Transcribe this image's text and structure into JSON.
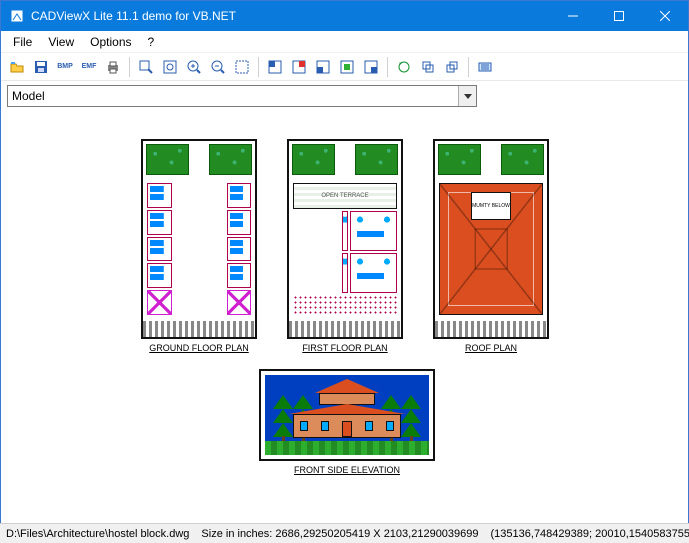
{
  "title": "CADViewX Lite 11.1 demo for VB.NET",
  "menu": {
    "file": "File",
    "view": "View",
    "options": "Options",
    "help": "?"
  },
  "toolbar": {
    "open": "open-icon",
    "save": "save-icon",
    "bmp": "BMP",
    "emf": "EMF",
    "print": "print-icon",
    "zoom_window": "zoom-window-icon",
    "zoom_extents": "zoom-extents-icon",
    "zoom_in": "zoom-in-icon",
    "zoom_out": "zoom-out-icon",
    "fit": "fit-icon",
    "g1": "tool",
    "g2": "tool",
    "g3": "tool",
    "g4": "tool",
    "g5": "tool",
    "g6": "tool",
    "h1": "tool",
    "h2": "tool",
    "h3": "tool",
    "h4": "tool"
  },
  "selector": {
    "value": "Model"
  },
  "drawings": {
    "ground": "GROUND FLOOR PLAN",
    "first": "FIRST FLOOR PLAN",
    "roof": "ROOF PLAN",
    "elevation": "FRONT SIDE ELEVATION",
    "open_terrace": "OPEN TERRACE",
    "mumty": "MUMTY BELOW"
  },
  "status": {
    "path": "D:\\Files\\Architecture\\hostel block.dwg",
    "size_label": "Size in inches:",
    "size": "2686,29250205419 X 2103,21290039699",
    "coords": "(135136,748429389; 20010,1540583755"
  }
}
